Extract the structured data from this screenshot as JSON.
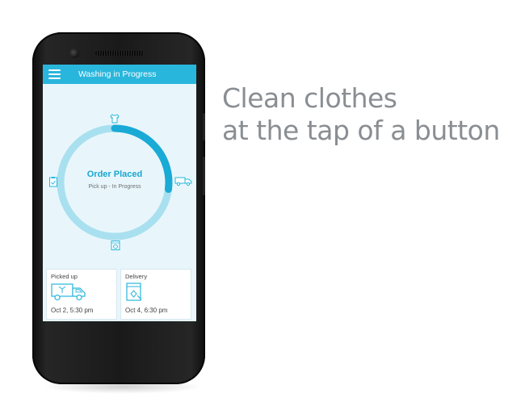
{
  "app": {
    "title": "Washing in Progress"
  },
  "status": {
    "title": "Order Placed",
    "subtitle": "Pick up - In Progress",
    "progress_fraction": 0.27,
    "colors": {
      "track": "#a9e0ef",
      "progress": "#1aaad6",
      "accent": "#29b6dc"
    },
    "stage_icons": [
      "shirt-icon",
      "delivery-truck-icon",
      "washer-icon",
      "clipboard-icon"
    ]
  },
  "cards": [
    {
      "title": "Picked up",
      "date": "Oct 2,  5:30 pm",
      "icon": "pickup-truck-icon"
    },
    {
      "title": "Delivery",
      "date": "Oct 4,  6:30 pm",
      "icon": "delivery-box-icon"
    }
  ],
  "tagline": {
    "line1": "Clean clothes",
    "line2": "at the tap of a button"
  }
}
